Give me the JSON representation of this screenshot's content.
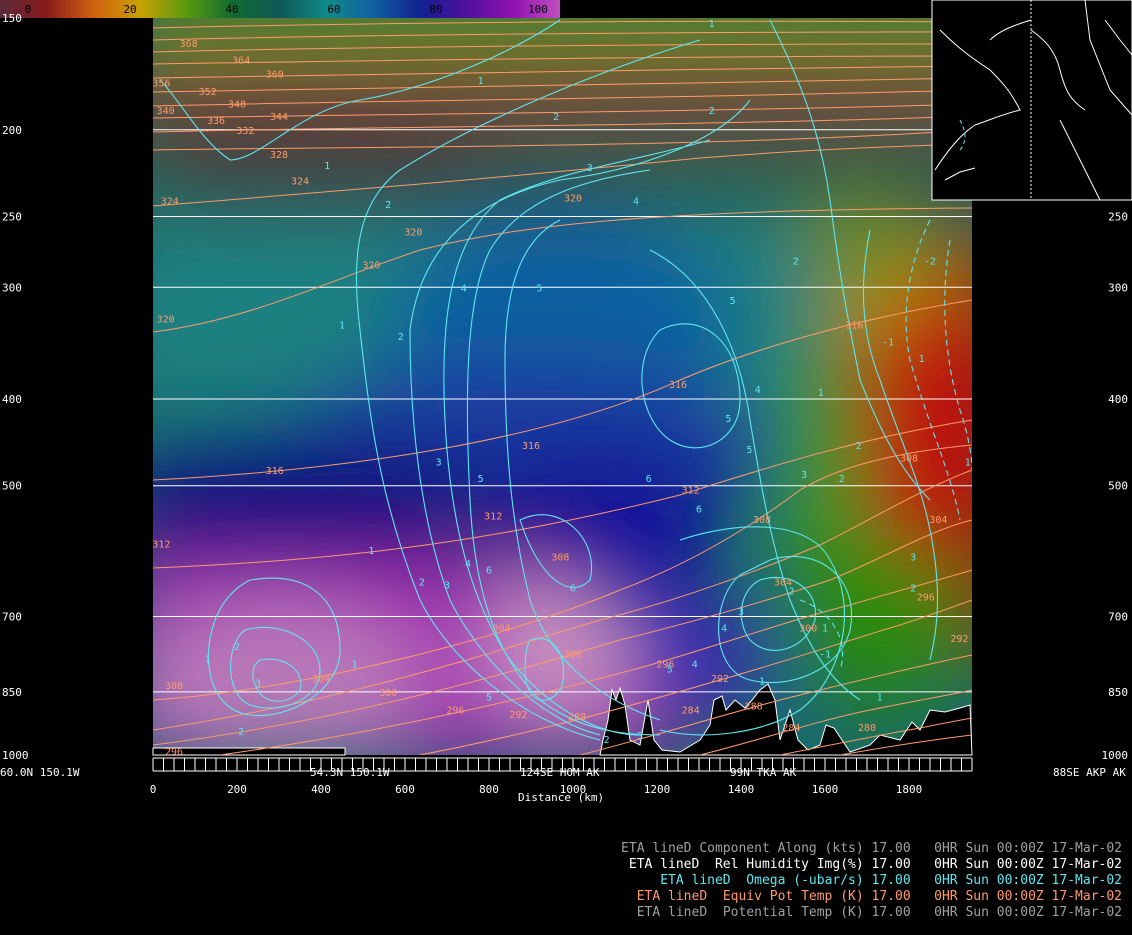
{
  "colorbar": {
    "labels": [
      "0",
      "20",
      "40",
      "60",
      "80",
      "100"
    ],
    "stops": [
      "#5a2a3a",
      "#8a1a1a",
      "#d06010",
      "#c8a000",
      "#5a9a10",
      "#106a30",
      "#105858",
      "#108a8a",
      "#1060a0",
      "#102090",
      "#5010a0",
      "#9010b0",
      "#c050c0"
    ]
  },
  "pressure_labels": [
    "150",
    "200",
    "250",
    "300",
    "400",
    "500",
    "700",
    "850",
    "1000"
  ],
  "station_labels": {
    "left": "60.0N 150.1W",
    "s1": "54.3N 150.1W",
    "s2": "124SE HOM AK",
    "s3": "99N TKA AK",
    "right": "88SE AKP AK"
  },
  "chart_data": {
    "type": "heatmap",
    "xlabel": "Distance (km)",
    "x_ticks": [
      0,
      200,
      400,
      600,
      800,
      1000,
      1200,
      1400,
      1600,
      1800
    ],
    "xlim": [
      0,
      1950
    ],
    "ylim": [
      1000,
      150
    ],
    "y_scale": "log-pressure",
    "y_ticks": [
      150,
      200,
      250,
      300,
      400,
      500,
      700,
      850,
      1000
    ],
    "series": [
      {
        "name": "Rel Humidity Img(%)",
        "kind": "image",
        "range": [
          0,
          100
        ]
      },
      {
        "name": "Omega (-ubar/s)",
        "kind": "contour",
        "color": "#5fe6f0",
        "labels": [
          "1",
          "2",
          "3",
          "4",
          "5",
          "6",
          "-1",
          "-2"
        ]
      },
      {
        "name": "Equiv Pot Temp (K)",
        "kind": "contour",
        "color": "#ff9a6a",
        "labels": [
          "284",
          "288",
          "292",
          "296",
          "300",
          "304",
          "308",
          "312",
          "316",
          "320",
          "324",
          "328",
          "332",
          "336",
          "340",
          "344",
          "348",
          "352",
          "356",
          "360",
          "364",
          "368"
        ]
      },
      {
        "name": "Potential Temp (K)",
        "kind": "contour",
        "color": "#b0b0b0"
      }
    ],
    "theta_labels": [
      {
        "v": "368",
        "x": 85,
        "p": 160
      },
      {
        "v": "364",
        "x": 210,
        "p": 167
      },
      {
        "v": "360",
        "x": 290,
        "p": 173
      },
      {
        "v": "356",
        "x": 20,
        "p": 177
      },
      {
        "v": "352",
        "x": 130,
        "p": 181
      },
      {
        "v": "348",
        "x": 200,
        "p": 187
      },
      {
        "v": "344",
        "x": 300,
        "p": 193
      },
      {
        "v": "340",
        "x": 30,
        "p": 190
      },
      {
        "v": "336",
        "x": 150,
        "p": 195
      },
      {
        "v": "332",
        "x": 220,
        "p": 200
      },
      {
        "v": "328",
        "x": 300,
        "p": 213
      },
      {
        "v": "324",
        "x": 40,
        "p": 240
      },
      {
        "v": "324",
        "x": 350,
        "p": 228
      },
      {
        "v": "320",
        "x": 1000,
        "p": 238
      },
      {
        "v": "320",
        "x": 620,
        "p": 260
      },
      {
        "v": "320",
        "x": 30,
        "p": 325
      },
      {
        "v": "320",
        "x": 520,
        "p": 283
      },
      {
        "v": "316",
        "x": 1670,
        "p": 330
      },
      {
        "v": "316",
        "x": 1250,
        "p": 385
      },
      {
        "v": "316",
        "x": 900,
        "p": 450
      },
      {
        "v": "316",
        "x": 290,
        "p": 480
      },
      {
        "v": "312",
        "x": 1280,
        "p": 505
      },
      {
        "v": "312",
        "x": 810,
        "p": 540
      },
      {
        "v": "312",
        "x": 20,
        "p": 580
      },
      {
        "v": "308",
        "x": 1450,
        "p": 545
      },
      {
        "v": "308",
        "x": 970,
        "p": 600
      },
      {
        "v": "308",
        "x": 1800,
        "p": 465
      },
      {
        "v": "308",
        "x": 50,
        "p": 835
      },
      {
        "v": "304",
        "x": 1500,
        "p": 640
      },
      {
        "v": "304",
        "x": 1870,
        "p": 545
      },
      {
        "v": "304",
        "x": 830,
        "p": 720
      },
      {
        "v": "304",
        "x": 400,
        "p": 820
      },
      {
        "v": "300",
        "x": 1560,
        "p": 720
      },
      {
        "v": "300",
        "x": 1000,
        "p": 770
      },
      {
        "v": "300",
        "x": 560,
        "p": 850
      },
      {
        "v": "296",
        "x": 1220,
        "p": 790
      },
      {
        "v": "296",
        "x": 720,
        "p": 890
      },
      {
        "v": "296",
        "x": 1840,
        "p": 665
      },
      {
        "v": "292",
        "x": 1350,
        "p": 820
      },
      {
        "v": "292",
        "x": 870,
        "p": 900
      },
      {
        "v": "288",
        "x": 1430,
        "p": 880
      },
      {
        "v": "288",
        "x": 1010,
        "p": 905
      },
      {
        "v": "284",
        "x": 1280,
        "p": 890
      },
      {
        "v": "284",
        "x": 1520,
        "p": 930
      },
      {
        "v": "280",
        "x": 1700,
        "p": 930
      },
      {
        "v": "296",
        "x": 50,
        "p": 990
      },
      {
        "v": "292",
        "x": 1920,
        "p": 740
      }
    ],
    "omega_labels": [
      {
        "v": "1",
        "x": 1330,
        "p": 152
      },
      {
        "v": "1",
        "x": 780,
        "p": 176
      },
      {
        "v": "1",
        "x": 415,
        "p": 219
      },
      {
        "v": "2",
        "x": 960,
        "p": 193
      },
      {
        "v": "2",
        "x": 1330,
        "p": 190
      },
      {
        "v": "2",
        "x": 560,
        "p": 242
      },
      {
        "v": "3",
        "x": 1040,
        "p": 220
      },
      {
        "v": "4",
        "x": 1150,
        "p": 240
      },
      {
        "v": "5",
        "x": 1380,
        "p": 310
      },
      {
        "v": "1",
        "x": 450,
        "p": 330
      },
      {
        "v": "2",
        "x": 590,
        "p": 340
      },
      {
        "v": "4",
        "x": 740,
        "p": 300
      },
      {
        "v": "5",
        "x": 920,
        "p": 300
      },
      {
        "v": "4",
        "x": 1440,
        "p": 390
      },
      {
        "v": "5",
        "x": 1420,
        "p": 455
      },
      {
        "v": "3",
        "x": 1550,
        "p": 485
      },
      {
        "v": "2",
        "x": 1640,
        "p": 490
      },
      {
        "v": "5",
        "x": 1370,
        "p": 420
      },
      {
        "v": "6",
        "x": 1180,
        "p": 490
      },
      {
        "v": "3",
        "x": 680,
        "p": 470
      },
      {
        "v": "5",
        "x": 780,
        "p": 490
      },
      {
        "v": "1",
        "x": 520,
        "p": 590
      },
      {
        "v": "2",
        "x": 640,
        "p": 640
      },
      {
        "v": "3",
        "x": 700,
        "p": 645
      },
      {
        "v": "4",
        "x": 750,
        "p": 610
      },
      {
        "v": "6",
        "x": 800,
        "p": 620
      },
      {
        "v": "6",
        "x": 1000,
        "p": 650
      },
      {
        "v": "6",
        "x": 1300,
        "p": 530
      },
      {
        "v": "2",
        "x": 1520,
        "p": 655
      },
      {
        "v": "3",
        "x": 1400,
        "p": 690
      },
      {
        "v": "4",
        "x": 1360,
        "p": 720
      },
      {
        "v": "1",
        "x": 1600,
        "p": 720
      },
      {
        "v": "-1",
        "x": 1600,
        "p": 770
      },
      {
        "v": "5",
        "x": 1230,
        "p": 800
      },
      {
        "v": "4",
        "x": 1290,
        "p": 790
      },
      {
        "v": "1",
        "x": 1450,
        "p": 825
      },
      {
        "v": "2",
        "x": 200,
        "p": 755
      },
      {
        "v": "3",
        "x": 250,
        "p": 830
      },
      {
        "v": "1",
        "x": 130,
        "p": 780
      },
      {
        "v": "2",
        "x": 210,
        "p": 940
      },
      {
        "v": "1",
        "x": 480,
        "p": 790
      },
      {
        "v": "5",
        "x": 800,
        "p": 860
      },
      {
        "v": "3",
        "x": 1160,
        "p": 950
      },
      {
        "v": "2",
        "x": 1080,
        "p": 960
      },
      {
        "v": "1",
        "x": 1730,
        "p": 860
      },
      {
        "v": "2",
        "x": 1810,
        "p": 650
      },
      {
        "v": "3",
        "x": 1810,
        "p": 600
      },
      {
        "v": "2",
        "x": 1680,
        "p": 450
      },
      {
        "v": "1",
        "x": 1830,
        "p": 360
      },
      {
        "v": "-1",
        "x": 1750,
        "p": 345
      },
      {
        "v": "-2",
        "x": 1850,
        "p": 280
      },
      {
        "v": "-1",
        "x": 1910,
        "p": 190
      },
      {
        "v": "1",
        "x": 1940,
        "p": 470
      },
      {
        "v": "2",
        "x": 1530,
        "p": 280
      },
      {
        "v": "1",
        "x": 1590,
        "p": 393
      }
    ]
  },
  "legend": [
    {
      "model": "ETA lineD",
      "field": "Component Along (kts)",
      "level": "17.00",
      "time": "0HR Sun 00:00Z 17-Mar-02",
      "color": "#a0a0a0"
    },
    {
      "model": "ETA lineD",
      "field": "Rel Humidity Img(%)",
      "level": "17.00",
      "time": "0HR Sun 00:00Z 17-Mar-02",
      "color": "#ffffff"
    },
    {
      "model": "ETA lineD",
      "field": "Omega (-ubar/s)",
      "level": "17.00",
      "time": "0HR Sun 00:00Z 17-Mar-02",
      "color": "#5fe6f0"
    },
    {
      "model": "ETA lineD",
      "field": "Equiv Pot Temp (K)",
      "level": "17.00",
      "time": "0HR Sun 00:00Z 17-Mar-02",
      "color": "#ff9a6a"
    },
    {
      "model": "ETA lineD",
      "field": "Potential Temp (K)",
      "level": "17.00",
      "time": "0HR Sun 00:00Z 17-Mar-02",
      "color": "#a0a0a0"
    }
  ]
}
